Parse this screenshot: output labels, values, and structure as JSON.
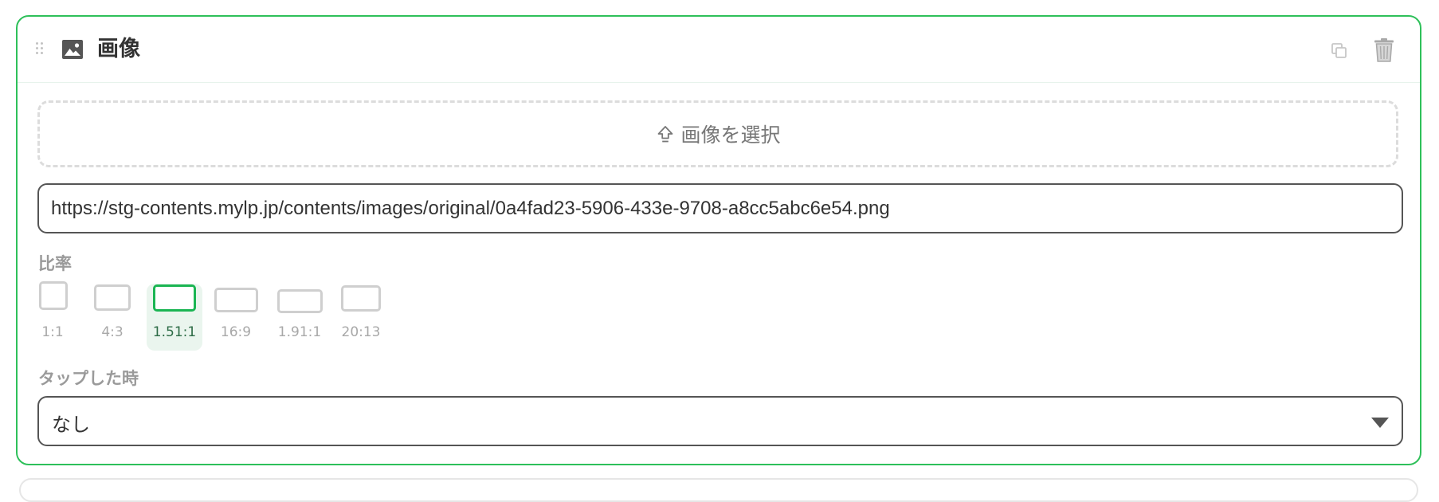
{
  "block": {
    "title": "画像",
    "icon": "image-icon",
    "actions": [
      "copy-icon",
      "trash-icon"
    ]
  },
  "upload": {
    "label": "画像を選択",
    "icon": "upload-icon"
  },
  "image_url": {
    "value": "https://stg-contents.mylp.jp/contents/images/original/0a4fad23-5906-433e-9708-a8cc5abc6e54.png"
  },
  "ratio": {
    "label": "比率",
    "options": [
      "1:1",
      "4:3",
      "1.51:1",
      "16:9",
      "1.91:1",
      "20:13"
    ],
    "selected": "1.51:1"
  },
  "tap_action": {
    "label": "タップした時",
    "value": "なし"
  },
  "colors": {
    "accent": "#2ec05a",
    "selected_bg": "#eaf5ee",
    "muted_text": "#9a9a9a"
  }
}
